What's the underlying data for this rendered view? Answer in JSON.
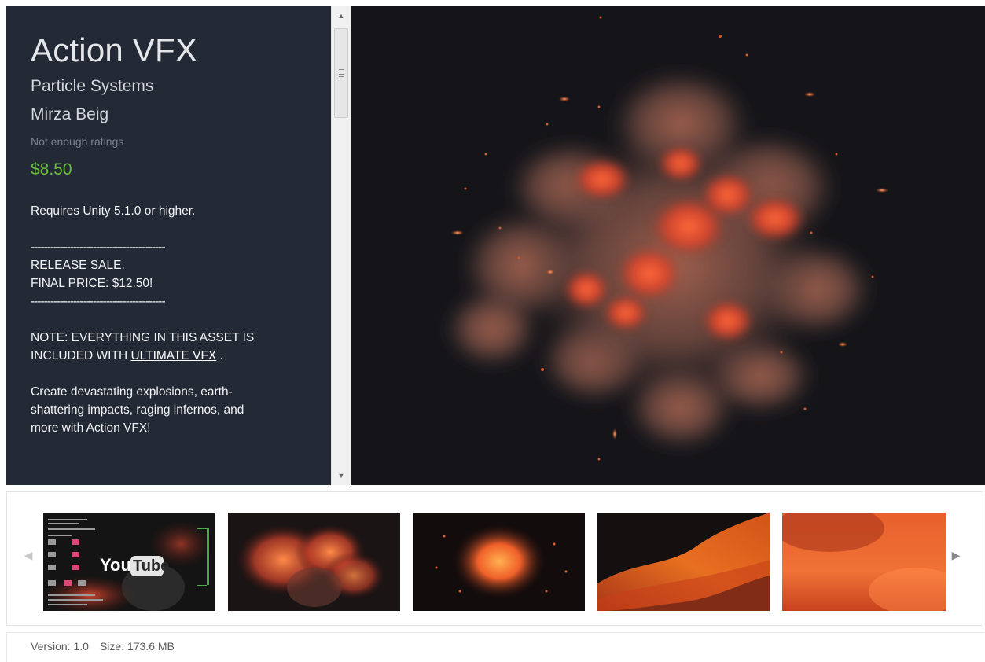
{
  "asset": {
    "title": "Action VFX",
    "category": "Particle Systems",
    "publisher": "Mirza Beig",
    "ratings": "Not enough ratings",
    "price": "$8.50"
  },
  "description": {
    "requires": "Requires Unity 5.1.0 or higher.",
    "rule_top": "-----------------------------------------",
    "sale_line1": "RELEASE SALE.",
    "sale_line2": "FINAL PRICE: $12.50!",
    "rule_bottom": "-----------------------------------------",
    "note_line1": "NOTE: EVERYTHING IN THIS ASSET IS",
    "note_line2_prefix": "INCLUDED WITH ",
    "note_link": "ULTIMATE VFX",
    "note_line2_suffix": " .",
    "body_line1": "Create devastating explosions, earth-",
    "body_line2": "shattering impacts, raging infernos, and",
    "body_line3": "more with Action VFX!"
  },
  "scrollbar": {
    "up_icon": "▲",
    "down_icon": "▼"
  },
  "gallery": {
    "prev_icon": "◀",
    "next_icon": "▶",
    "youtube_you": "You",
    "youtube_tube": "Tube"
  },
  "footer": {
    "version": "Version: 1.0",
    "size": "Size: 173.6 MB"
  },
  "colors": {
    "panel_bg": "#232a36",
    "price": "#6bbd3c",
    "hero_bg": "#151519"
  }
}
